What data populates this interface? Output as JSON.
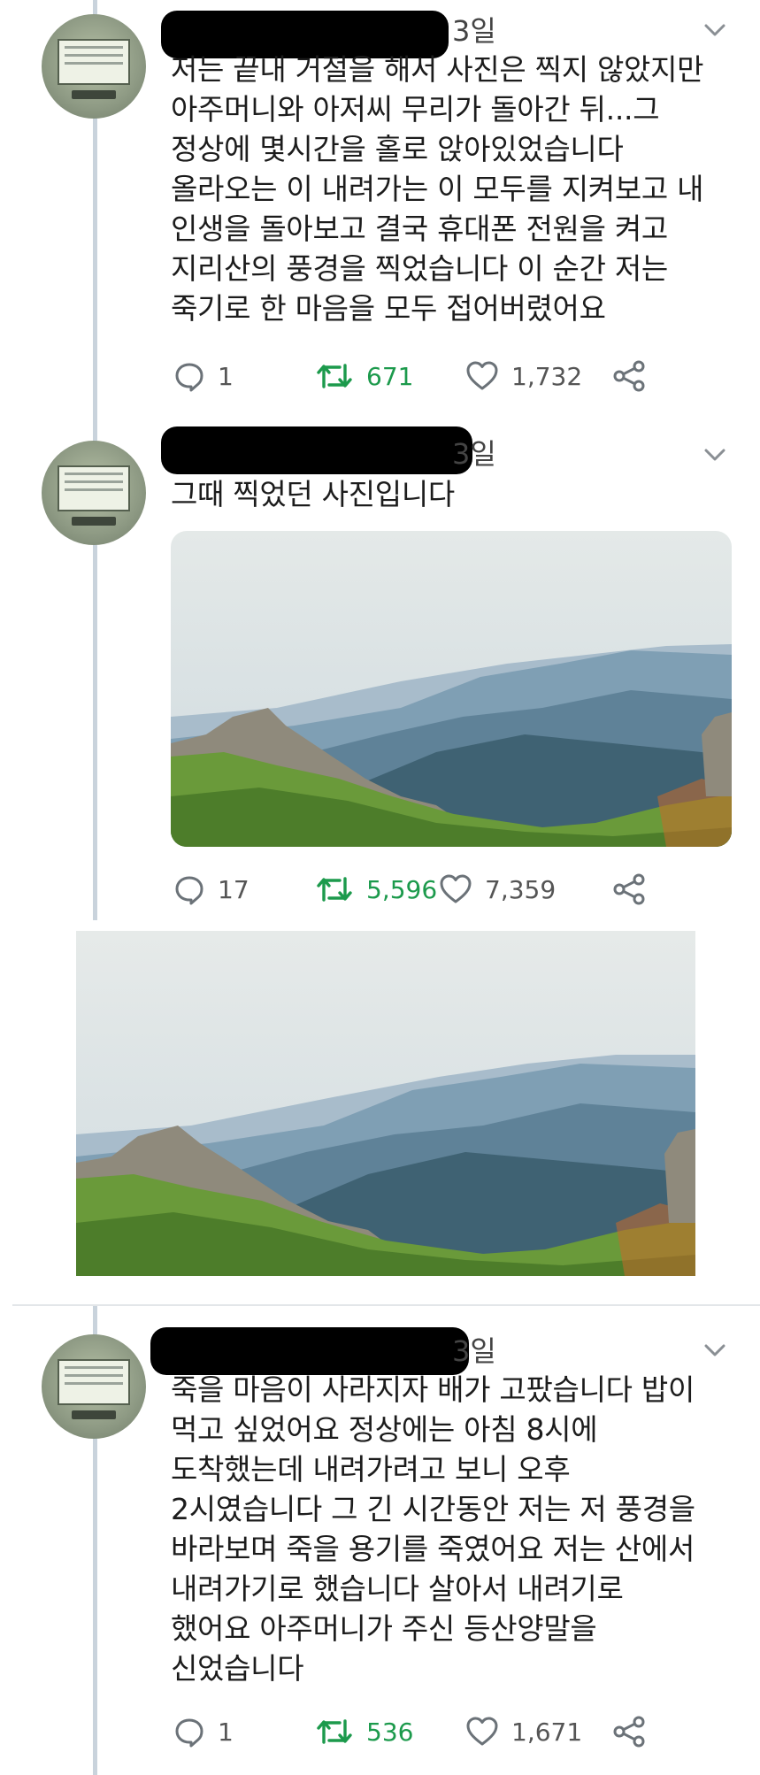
{
  "tweets": [
    {
      "date": "3일",
      "text": "저는 끝내 거절을 해서 사진은 찍지 않았지만\n아주머니와 아저씨 무리가 돌아간 뒤...그\n정상에 몇시간을 홀로 앉아있었습니다\n올라오는 이 내려가는 이 모두를 지켜보고 내\n인생을 돌아보고 결국 휴대폰 전원을 켜고\n지리산의 풍경을 찍었습니다 이 순간 저는\n죽기로 한 마음을 모두 접어버렸어요",
      "replies": "1",
      "retweets": "671",
      "likes": "1,732"
    },
    {
      "date": "3일",
      "text": "그때 찍었던 사진입니다",
      "replies": "17",
      "retweets": "5,596",
      "likes": "7,359"
    },
    {
      "date": "3일",
      "text": "죽을 마음이 사라지자 배가 고팠습니다 밥이\n먹고 싶었어요 정상에는 아침 8시에\n도착했는데 내려가려고 보니 오후\n2시였습니다 그 긴 시간동안 저는 저 풍경을\n바라보며 죽을 용기를 죽였어요 저는 산에서\n내려가기로 했습니다 살아서 내려기로\n했어요 아주머니가 주신 등산양말을\n신었습니다",
      "replies": "1",
      "retweets": "536",
      "likes": "1,671"
    }
  ],
  "icons": {
    "reply": "reply-icon",
    "retweet": "retweet-icon",
    "like": "heart-icon",
    "share": "share-icon",
    "menu": "chevron-down-icon"
  },
  "colors": {
    "retweet_active": "#1c9a4c",
    "thread_line": "#c9d3dc",
    "text": "#1c1c1c",
    "meta": "#555555"
  }
}
